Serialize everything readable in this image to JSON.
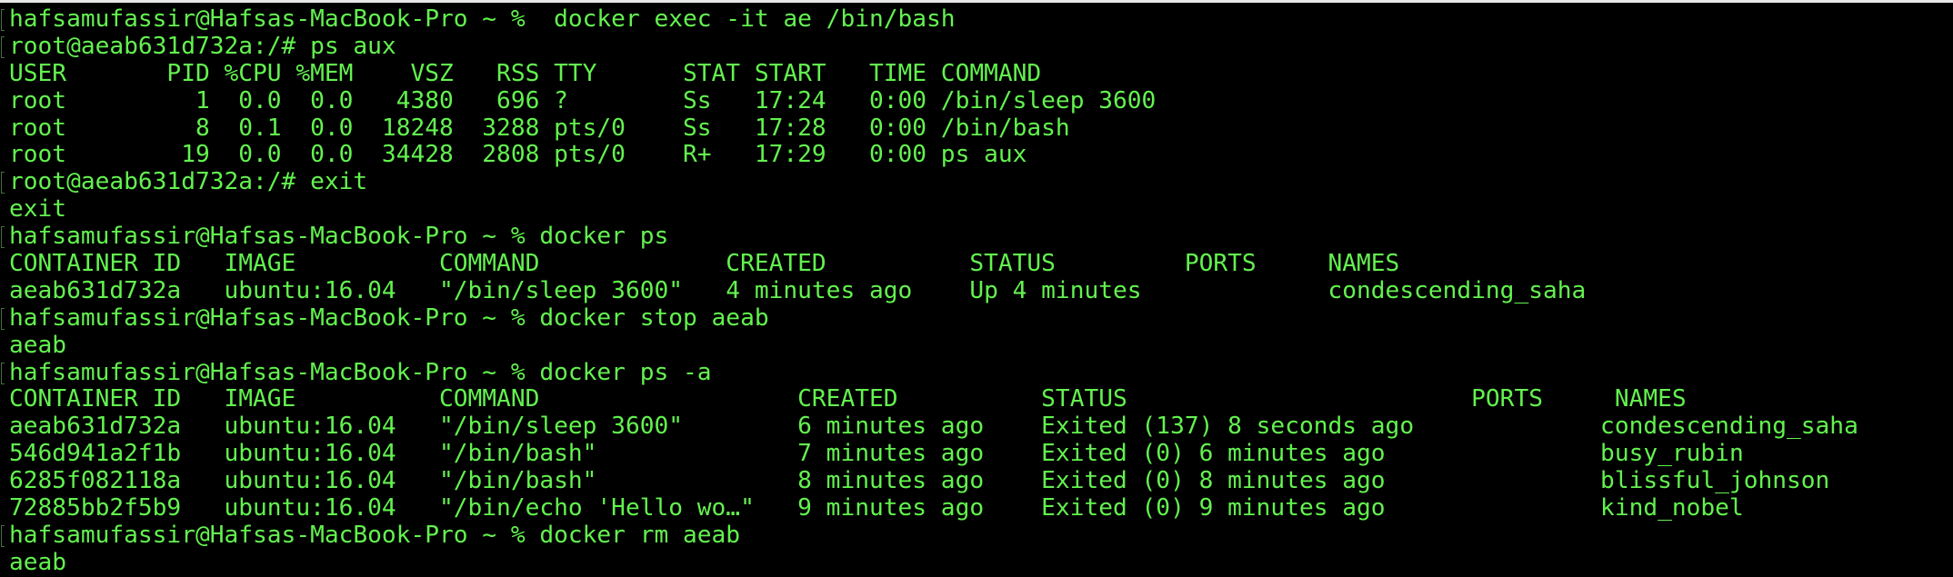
{
  "terminal": {
    "text_color": "#63f24f",
    "background": "#000000",
    "lines": [
      "hafsamufassir@Hafsas-MacBook-Pro ~ %  docker exec -it ae /bin/bash",
      "root@aeab631d732a:/# ps aux",
      "USER       PID %CPU %MEM    VSZ   RSS TTY      STAT START   TIME COMMAND",
      "root         1  0.0  0.0   4380   696 ?        Ss   17:24   0:00 /bin/sleep 3600",
      "root         8  0.1  0.0  18248  3288 pts/0    Ss   17:28   0:00 /bin/bash",
      "root        19  0.0  0.0  34428  2808 pts/0    R+   17:29   0:00 ps aux",
      "root@aeab631d732a:/# exit",
      "exit",
      "hafsamufassir@Hafsas-MacBook-Pro ~ % docker ps",
      "CONTAINER ID   IMAGE          COMMAND             CREATED          STATUS         PORTS     NAMES",
      "aeab631d732a   ubuntu:16.04   \"/bin/sleep 3600\"   4 minutes ago    Up 4 minutes             condescending_saha",
      "hafsamufassir@Hafsas-MacBook-Pro ~ % docker stop aeab",
      "aeab",
      "hafsamufassir@Hafsas-MacBook-Pro ~ % docker ps -a",
      "CONTAINER ID   IMAGE          COMMAND                  CREATED          STATUS                        PORTS     NAMES",
      "aeab631d732a   ubuntu:16.04   \"/bin/sleep 3600\"        6 minutes ago    Exited (137) 8 seconds ago             condescending_saha",
      "546d941a2f1b   ubuntu:16.04   \"/bin/bash\"              7 minutes ago    Exited (0) 6 minutes ago               busy_rubin",
      "6285f082118a   ubuntu:16.04   \"/bin/bash\"              8 minutes ago    Exited (0) 8 minutes ago               blissful_johnson",
      "72885bb2f5b9   ubuntu:16.04   \"/bin/echo 'Hello wo…\"   9 minutes ago    Exited (0) 9 minutes ago               kind_nobel",
      "hafsamufassir@Hafsas-MacBook-Pro ~ % docker rm aeab",
      "aeab"
    ]
  }
}
